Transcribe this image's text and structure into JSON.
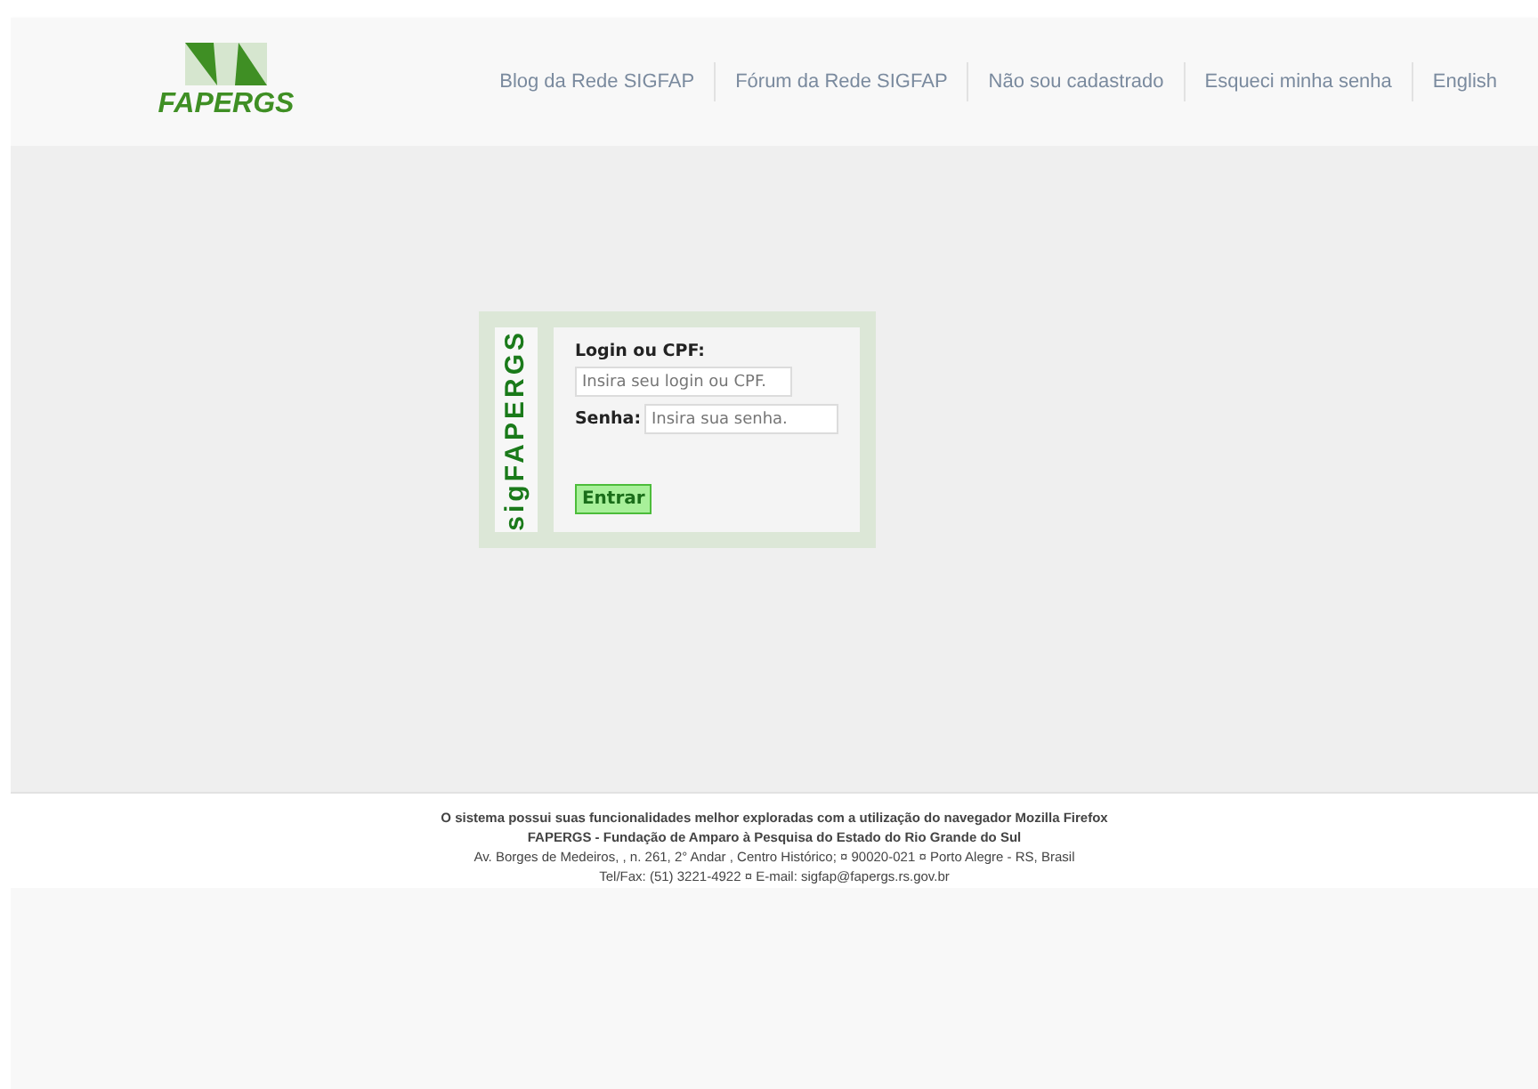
{
  "header": {
    "logo": "FAPERGS",
    "nav": [
      "Blog da Rede SIGFAP",
      "Fórum da Rede SIGFAP",
      "Não sou cadastrado",
      "Esqueci minha senha",
      "English"
    ]
  },
  "login": {
    "side_logo": "sigFAPERGS",
    "login_label": "Login ou CPF:",
    "login_placeholder": "Insira seu login ou CPF.",
    "password_label": "Senha:",
    "password_placeholder": "Insira sua senha.",
    "submit": "Entrar"
  },
  "footer": [
    "O sistema possui suas funcionalidades melhor exploradas com a utilização do navegador Mozilla Firefox",
    "FAPERGS - Fundação de Amparo à Pesquisa do Estado do Rio Grande do Sul",
    "Av. Borges de Medeiros, , n. 261, 2° Andar , Centro Histórico; ¤ 90020-021 ¤ Porto Alegre - RS, Brasil",
    "Tel/Fax: (51) 3221-4922 ¤ E-mail: sigfap@fapergs.rs.gov.br"
  ]
}
